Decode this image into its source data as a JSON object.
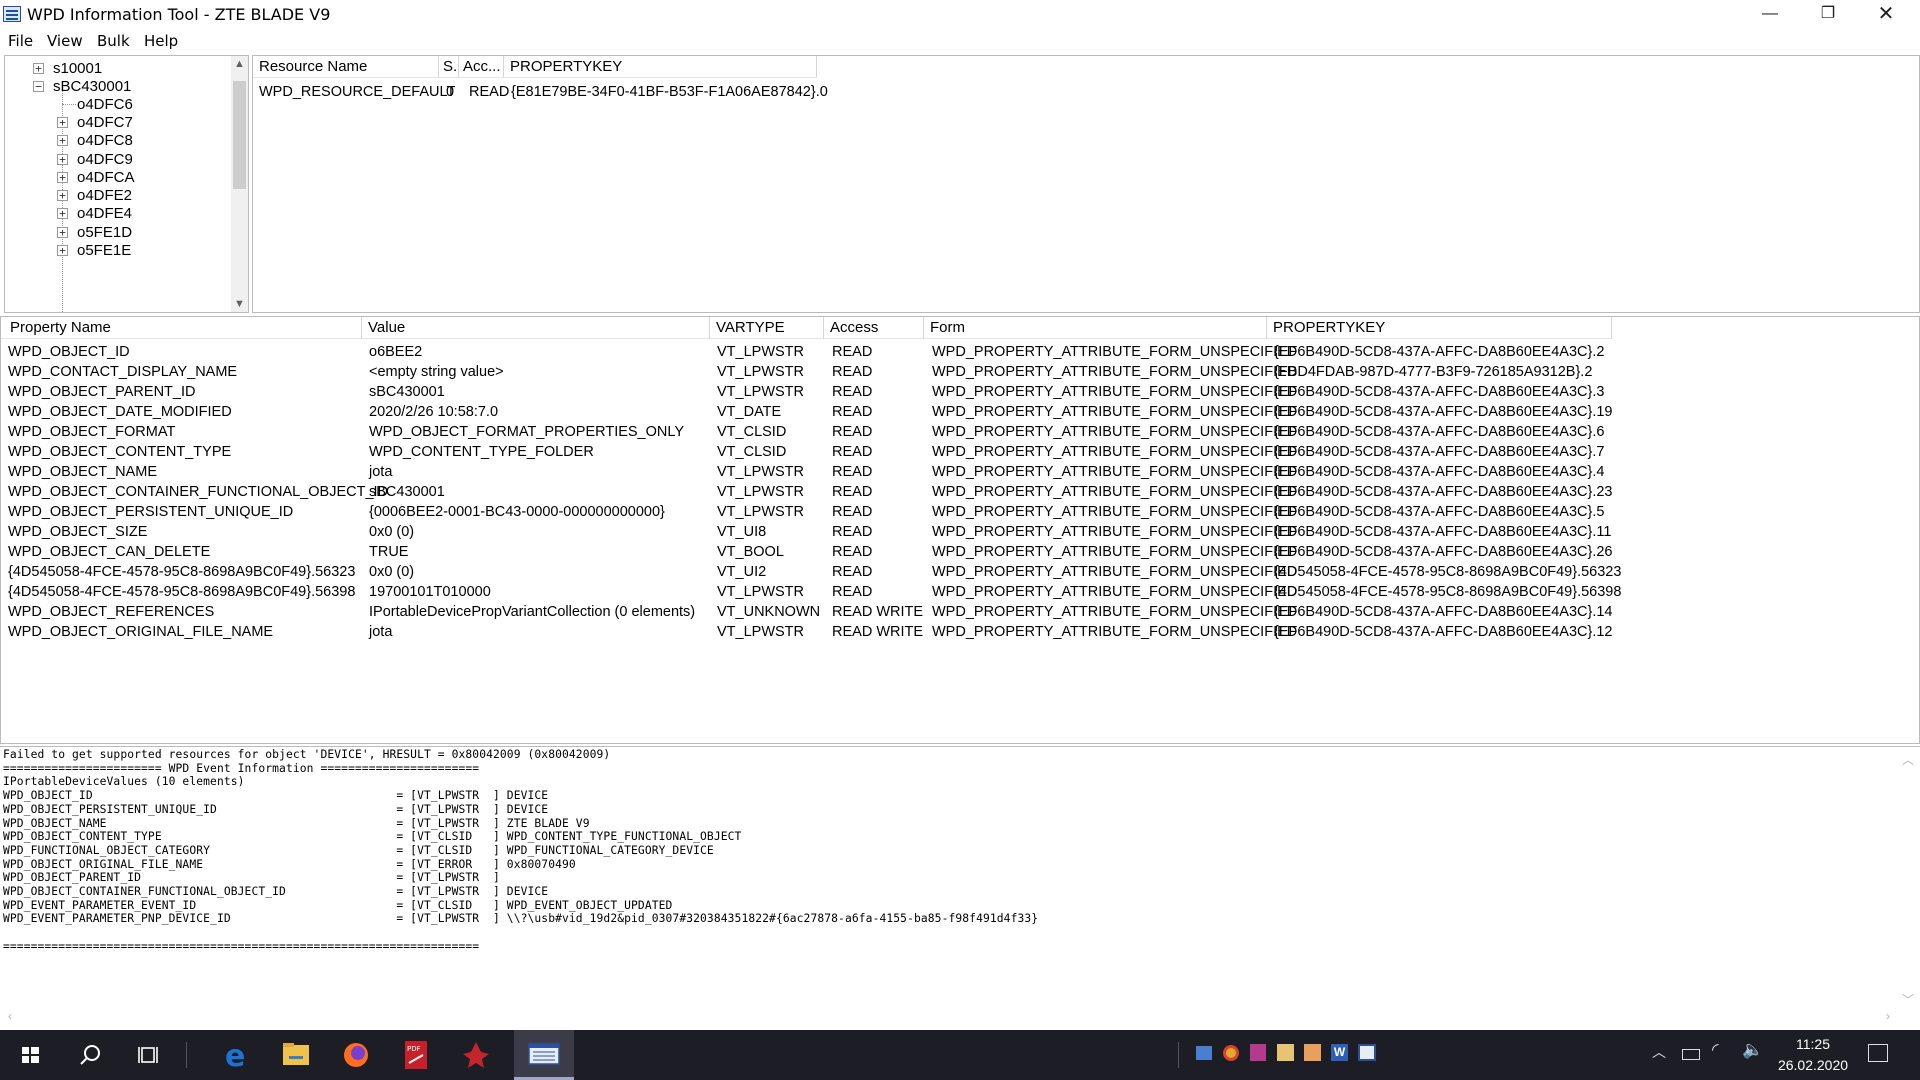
{
  "window": {
    "title": "WPD Information Tool - ZTE BLADE V9",
    "minimize_glyph": "—",
    "maximize_glyph": "❐",
    "close_glyph": "✕"
  },
  "menu": [
    "File",
    "View",
    "Bulk",
    "Help"
  ],
  "tree": {
    "items": [
      {
        "label": "s10001",
        "expander": "+"
      },
      {
        "label": "sBC430001",
        "expander": "−"
      },
      {
        "label": "o4DFC6",
        "expander": ""
      },
      {
        "label": "o4DFC7",
        "expander": "+"
      },
      {
        "label": "o4DFC8",
        "expander": "+"
      },
      {
        "label": "o4DFC9",
        "expander": "+"
      },
      {
        "label": "o4DFCA",
        "expander": "+"
      },
      {
        "label": "o4DFE2",
        "expander": "+"
      },
      {
        "label": "o4DFE4",
        "expander": "+"
      },
      {
        "label": "o5FE1D",
        "expander": "+"
      },
      {
        "label": "o5FE1E",
        "expander": "+"
      }
    ],
    "scroll_up": "▲",
    "scroll_down": "▼"
  },
  "resources": {
    "headers": [
      "Resource Name",
      "S.",
      "Acc...",
      "PROPERTYKEY"
    ],
    "rows": [
      [
        "WPD_RESOURCE_DEFAULT",
        "0",
        "READ",
        "{E81E79BE-34F0-41BF-B53F-F1A06AE87842}.0"
      ]
    ]
  },
  "properties": {
    "headers": [
      "Property Name",
      "Value",
      "VARTYPE",
      "Access",
      "Form",
      "PROPERTYKEY"
    ],
    "rows": [
      [
        "WPD_OBJECT_ID",
        "o6BEE2",
        "VT_LPWSTR",
        "READ",
        "WPD_PROPERTY_ATTRIBUTE_FORM_UNSPECIFIED",
        "{EF6B490D-5CD8-437A-AFFC-DA8B60EE4A3C}.2"
      ],
      [
        "WPD_CONTACT_DISPLAY_NAME",
        "<empty string value>",
        "VT_LPWSTR",
        "READ",
        "WPD_PROPERTY_ATTRIBUTE_FORM_UNSPECIFIED",
        "{FBD4FDAB-987D-4777-B3F9-726185A9312B}.2"
      ],
      [
        "WPD_OBJECT_PARENT_ID",
        "sBC430001",
        "VT_LPWSTR",
        "READ",
        "WPD_PROPERTY_ATTRIBUTE_FORM_UNSPECIFIED",
        "{EF6B490D-5CD8-437A-AFFC-DA8B60EE4A3C}.3"
      ],
      [
        "WPD_OBJECT_DATE_MODIFIED",
        "2020/2/26 10:58:7.0",
        "VT_DATE",
        "READ",
        "WPD_PROPERTY_ATTRIBUTE_FORM_UNSPECIFIED",
        "{EF6B490D-5CD8-437A-AFFC-DA8B60EE4A3C}.19"
      ],
      [
        "WPD_OBJECT_FORMAT",
        "WPD_OBJECT_FORMAT_PROPERTIES_ONLY",
        "VT_CLSID",
        "READ",
        "WPD_PROPERTY_ATTRIBUTE_FORM_UNSPECIFIED",
        "{EF6B490D-5CD8-437A-AFFC-DA8B60EE4A3C}.6"
      ],
      [
        "WPD_OBJECT_CONTENT_TYPE",
        "WPD_CONTENT_TYPE_FOLDER",
        "VT_CLSID",
        "READ",
        "WPD_PROPERTY_ATTRIBUTE_FORM_UNSPECIFIED",
        "{EF6B490D-5CD8-437A-AFFC-DA8B60EE4A3C}.7"
      ],
      [
        "WPD_OBJECT_NAME",
        "jota",
        "VT_LPWSTR",
        "READ",
        "WPD_PROPERTY_ATTRIBUTE_FORM_UNSPECIFIED",
        "{EF6B490D-5CD8-437A-AFFC-DA8B60EE4A3C}.4"
      ],
      [
        "WPD_OBJECT_CONTAINER_FUNCTIONAL_OBJECT_ID",
        "sBC430001",
        "VT_LPWSTR",
        "READ",
        "WPD_PROPERTY_ATTRIBUTE_FORM_UNSPECIFIED",
        "{EF6B490D-5CD8-437A-AFFC-DA8B60EE4A3C}.23"
      ],
      [
        "WPD_OBJECT_PERSISTENT_UNIQUE_ID",
        "{0006BEE2-0001-BC43-0000-000000000000}",
        "VT_LPWSTR",
        "READ",
        "WPD_PROPERTY_ATTRIBUTE_FORM_UNSPECIFIED",
        "{EF6B490D-5CD8-437A-AFFC-DA8B60EE4A3C}.5"
      ],
      [
        "WPD_OBJECT_SIZE",
        "0x0 (0)",
        "VT_UI8",
        "READ",
        "WPD_PROPERTY_ATTRIBUTE_FORM_UNSPECIFIED",
        "{EF6B490D-5CD8-437A-AFFC-DA8B60EE4A3C}.11"
      ],
      [
        "WPD_OBJECT_CAN_DELETE",
        "TRUE",
        "VT_BOOL",
        "READ",
        "WPD_PROPERTY_ATTRIBUTE_FORM_UNSPECIFIED",
        "{EF6B490D-5CD8-437A-AFFC-DA8B60EE4A3C}.26"
      ],
      [
        "{4D545058-4FCE-4578-95C8-8698A9BC0F49}.56323",
        "0x0 (0)",
        "VT_UI2",
        "READ",
        "WPD_PROPERTY_ATTRIBUTE_FORM_UNSPECIFIED",
        "{4D545058-4FCE-4578-95C8-8698A9BC0F49}.56323"
      ],
      [
        "{4D545058-4FCE-4578-95C8-8698A9BC0F49}.56398",
        "19700101T010000",
        "VT_LPWSTR",
        "READ",
        "WPD_PROPERTY_ATTRIBUTE_FORM_UNSPECIFIED",
        "{4D545058-4FCE-4578-95C8-8698A9BC0F49}.56398"
      ],
      [
        "WPD_OBJECT_REFERENCES",
        "IPortableDevicePropVariantCollection (0 elements)",
        "VT_UNKNOWN",
        "READ WRITE",
        "WPD_PROPERTY_ATTRIBUTE_FORM_UNSPECIFIED",
        "{EF6B490D-5CD8-437A-AFFC-DA8B60EE4A3C}.14"
      ],
      [
        "WPD_OBJECT_ORIGINAL_FILE_NAME",
        "jota",
        "VT_LPWSTR",
        "READ WRITE",
        "WPD_PROPERTY_ATTRIBUTE_FORM_UNSPECIFIED",
        "{EF6B490D-5CD8-437A-AFFC-DA8B60EE4A3C}.12"
      ]
    ]
  },
  "log": {
    "lines": [
      "Failed to get supported resources for object 'DEVICE', HRESULT = 0x80042009 (0x80042009)",
      "======================= WPD Event Information =======================",
      "IPortableDeviceValues (10 elements)",
      "WPD_OBJECT_ID                                            = [VT_LPWSTR  ] DEVICE",
      "WPD_OBJECT_PERSISTENT_UNIQUE_ID                          = [VT_LPWSTR  ] DEVICE",
      "WPD_OBJECT_NAME                                          = [VT_LPWSTR  ] ZTE BLADE V9",
      "WPD_OBJECT_CONTENT_TYPE                                  = [VT_CLSID   ] WPD_CONTENT_TYPE_FUNCTIONAL_OBJECT",
      "WPD_FUNCTIONAL_OBJECT_CATEGORY                           = [VT_CLSID   ] WPD_FUNCTIONAL_CATEGORY_DEVICE",
      "WPD_OBJECT_ORIGINAL_FILE_NAME                            = [VT_ERROR   ] 0x80070490",
      "WPD_OBJECT_PARENT_ID                                     = [VT_LPWSTR  ]",
      "WPD_OBJECT_CONTAINER_FUNCTIONAL_OBJECT_ID                = [VT_LPWSTR  ] DEVICE",
      "WPD_EVENT_PARAMETER_EVENT_ID                             = [VT_CLSID   ] WPD_EVENT_OBJECT_UPDATED",
      "WPD_EVENT_PARAMETER_PNP_DEVICE_ID                        = [VT_LPWSTR  ] \\\\?\\usb#vid_19d2&pid_0307#320384351822#{6ac27878-a6fa-4155-ba85-f98f491d4f33}",
      "",
      "====================================================================="
    ]
  },
  "taskbar": {
    "time": "11:25",
    "date": "26.02.2020",
    "apps": [
      "start-icon",
      "search-icon",
      "task-view-icon",
      "edge-icon",
      "file-explorer-icon",
      "firefox-icon",
      "pdf-icon",
      "red-app-icon",
      "wpd-tool-icon"
    ]
  },
  "colors": {
    "taskbar_bg": "#1d1d25",
    "edge_blue": "#1e73d2",
    "folder_yellow": "#f0c24b",
    "firefox_orange": "#ff6d1f",
    "pdf_red": "#c8202a"
  }
}
